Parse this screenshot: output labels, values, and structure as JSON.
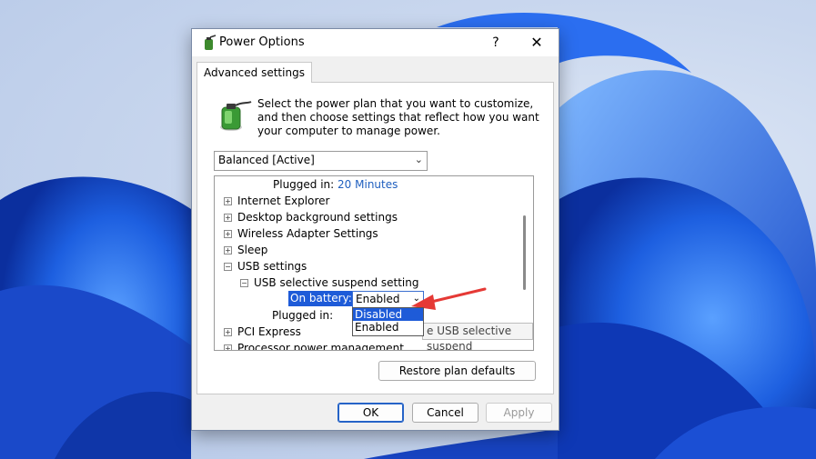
{
  "window": {
    "title": "Power Options",
    "help_label": "?",
    "close_label": "✕"
  },
  "tab": {
    "label": "Advanced settings"
  },
  "description": "Select the power plan that you want to customize, and then choose settings that reflect how you want your computer to manage power.",
  "plan_select": {
    "value": "Balanced [Active]"
  },
  "tree": {
    "plugged_in_top": {
      "label": "Plugged in:",
      "value": "20 Minutes"
    },
    "items": [
      {
        "label": "Internet Explorer",
        "expander": "+"
      },
      {
        "label": "Desktop background settings",
        "expander": "+"
      },
      {
        "label": "Wireless Adapter Settings",
        "expander": "+"
      },
      {
        "label": "Sleep",
        "expander": "+"
      },
      {
        "label": "USB settings",
        "expander": "−"
      },
      {
        "label": "USB selective suspend setting",
        "expander": "−"
      }
    ],
    "on_battery": {
      "label": "On battery:",
      "value": "Enabled"
    },
    "plugged_in_bottom": {
      "label": "Plugged in:"
    },
    "dropdown_options": [
      "Disabled",
      "Enabled"
    ],
    "tooltip": "e USB selective suspend",
    "pci_express": {
      "label": "PCI Express",
      "expander": "+"
    },
    "processor": {
      "label": "Processor power management",
      "expander": "+"
    }
  },
  "buttons": {
    "restore": "Restore plan defaults",
    "ok": "OK",
    "cancel": "Cancel",
    "apply": "Apply"
  },
  "colors": {
    "accent": "#1e5bd8",
    "link": "#1f5fbf",
    "arrow": "#e53935"
  }
}
